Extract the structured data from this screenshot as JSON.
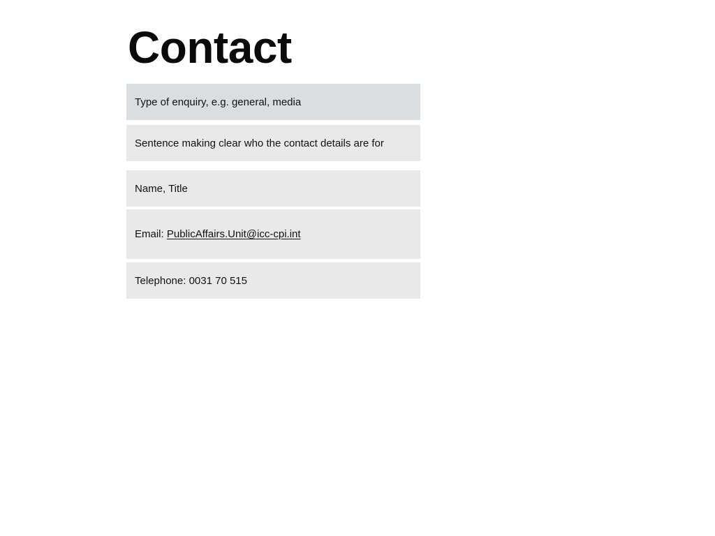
{
  "page": {
    "title": "Contact"
  },
  "contact": {
    "enquiry_type": "Type of enquiry, e.g. general, media",
    "sentence": "Sentence making clear who the contact details are for",
    "name_title": "Name, Title",
    "email_label": "Email:",
    "email_value": "PublicAffairs.Unit@icc-cpi.int",
    "telephone_label": "Telephone:",
    "telephone_value": "0031 70 515"
  },
  "colors": {
    "header_card_bg": "#dcdddf",
    "card_bg": "#e9e9e9",
    "text": "#111111",
    "page_bg": "#ffffff"
  }
}
